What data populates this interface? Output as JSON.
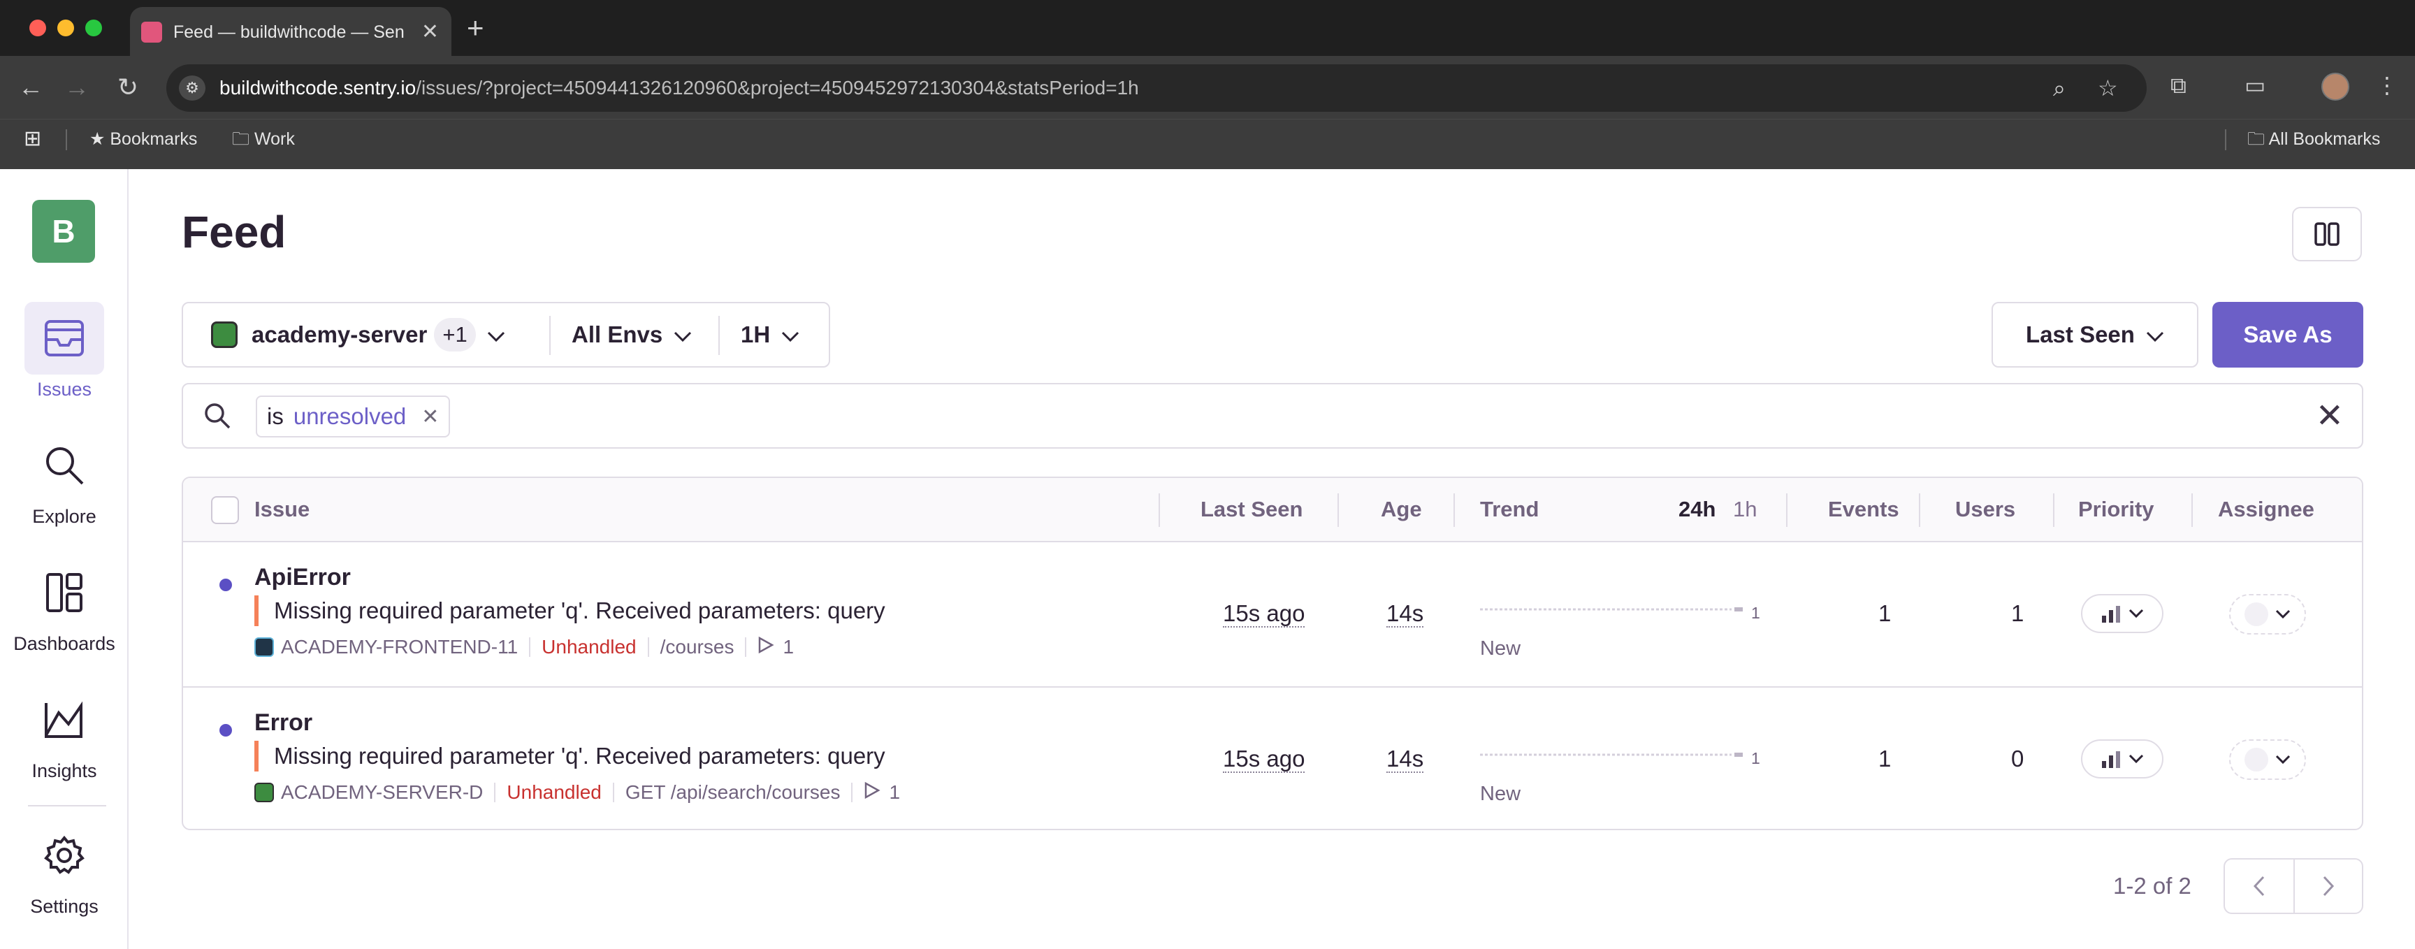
{
  "browser": {
    "tab_title": "Feed — buildwithcode — Sentry",
    "new_tab_symbol": "+",
    "url_host": "buildwithcode.sentry.io",
    "url_path": "/issues/?project=4509441326120960&project=4509452972130304&statsPeriod=1h",
    "bookmarks": {
      "bookmarks_label": "Bookmarks",
      "work_label": "Work",
      "all_bookmarks_label": "All Bookmarks"
    }
  },
  "sidenav": {
    "org_initial": "B",
    "items": [
      {
        "label": "Issues",
        "icon": "issues-icon",
        "active": true
      },
      {
        "label": "Explore",
        "icon": "explore-icon"
      },
      {
        "label": "Dashboards",
        "icon": "dashboards-icon"
      },
      {
        "label": "Insights",
        "icon": "insights-icon"
      },
      {
        "label": "Settings",
        "icon": "settings-icon"
      }
    ]
  },
  "page": {
    "title": "Feed"
  },
  "filters": {
    "project": "academy-server",
    "project_extra": "+1",
    "environment": "All Envs",
    "period": "1H",
    "sort": "Last Seen",
    "save_label": "Save As"
  },
  "search": {
    "token_key": "is",
    "token_value": "unresolved"
  },
  "table": {
    "headers": {
      "issue": "Issue",
      "last_seen": "Last Seen",
      "age": "Age",
      "trend": "Trend",
      "period_24h": "24h",
      "period_1h": "1h",
      "events": "Events",
      "users": "Users",
      "priority": "Priority",
      "assignee": "Assignee"
    },
    "rows": [
      {
        "title": "ApiError",
        "message": "Missing required parameter 'q'. Received parameters: query",
        "short_id": "ACADEMY-FRONTEND-11",
        "handled": "Unhandled",
        "culprit": "/courses",
        "replay_count": "1",
        "last_seen": "15s ago",
        "age": "14s",
        "trend_max": "1",
        "trend_label": "New",
        "events": "1",
        "users": "1",
        "platform_icon": "react-icon"
      },
      {
        "title": "Error",
        "message": "Missing required parameter 'q'. Received parameters: query",
        "short_id": "ACADEMY-SERVER-D",
        "handled": "Unhandled",
        "culprit": "GET /api/search/courses",
        "replay_count": "1",
        "last_seen": "15s ago",
        "age": "14s",
        "trend_max": "1",
        "trend_label": "New",
        "events": "1",
        "users": "0",
        "platform_icon": "node-icon"
      }
    ]
  },
  "pagination": {
    "text": "1-2 of 2"
  },
  "colors": {
    "accent": "#6c5fc7",
    "unhandled": "#c8312f",
    "level_bar": "#f58159"
  }
}
